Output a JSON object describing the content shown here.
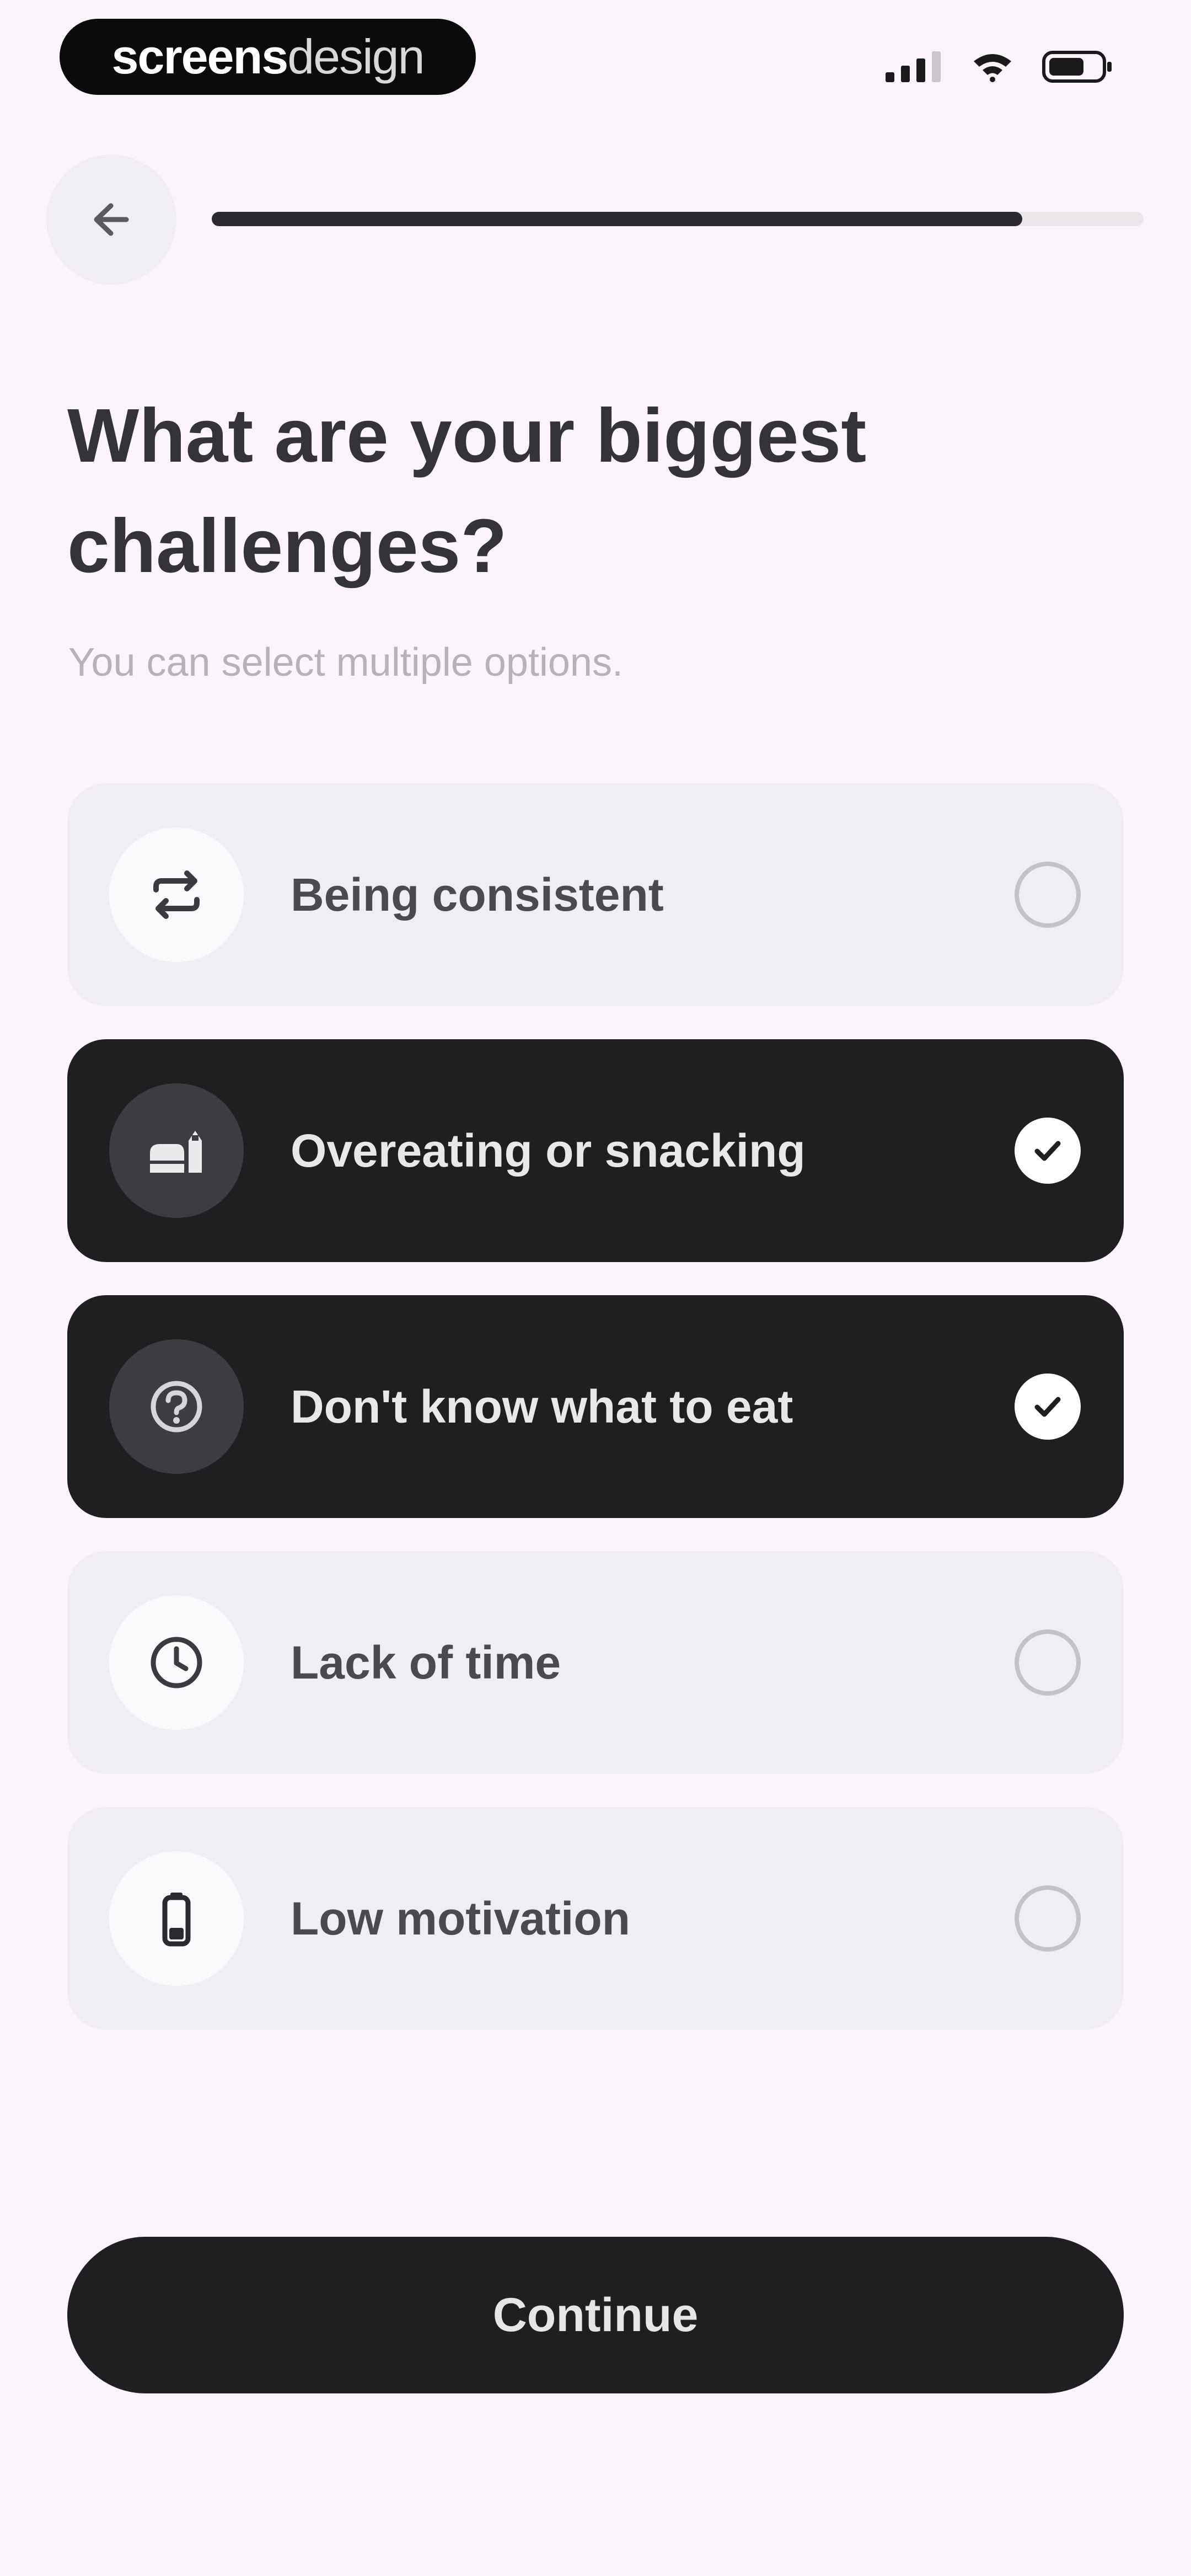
{
  "status_bar": {
    "brand_bold": "screens",
    "brand_light": "design"
  },
  "nav": {
    "progress": 0.87
  },
  "header": {
    "title": "What are your biggest challenges?",
    "subtitle": "You can select multiple options."
  },
  "options": [
    {
      "label": "Being consistent",
      "icon": "repeat-icon",
      "selected": false
    },
    {
      "label": "Overeating or snacking",
      "icon": "food-icon",
      "selected": true
    },
    {
      "label": "Don't know what to eat",
      "icon": "question-icon",
      "selected": true
    },
    {
      "label": "Lack of time",
      "icon": "clock-icon",
      "selected": false
    },
    {
      "label": "Low motivation",
      "icon": "battery-low-icon",
      "selected": false
    }
  ],
  "footer": {
    "continue_label": "Continue"
  },
  "colors": {
    "background": "#fcf4fb",
    "accent": "#1f1f22",
    "option_background": "#f0eef2"
  }
}
